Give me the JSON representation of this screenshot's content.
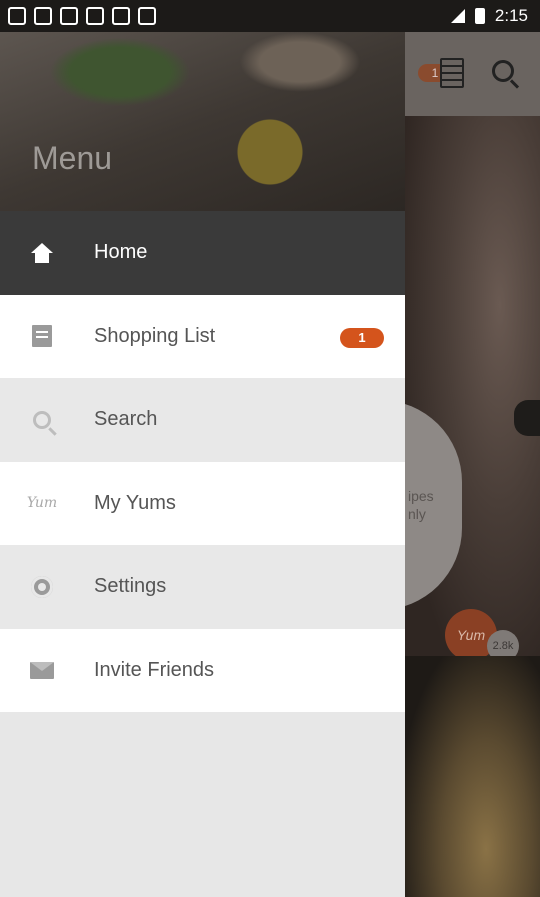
{
  "status_bar": {
    "time": "2:15"
  },
  "background": {
    "cart_badge": "1",
    "bubble_text_line1": "ipes",
    "bubble_text_line2": "nly",
    "yum_label": "Yum",
    "yum_count": "2.8k"
  },
  "drawer": {
    "title": "Menu",
    "items": [
      {
        "label": "Home",
        "icon": "home-icon"
      },
      {
        "label": "Shopping List",
        "icon": "list-icon",
        "badge": "1"
      },
      {
        "label": "Search",
        "icon": "search-icon"
      },
      {
        "label": "My Yums",
        "icon": "yum-icon",
        "icon_text": "Yum"
      },
      {
        "label": "Settings",
        "icon": "gear-icon"
      },
      {
        "label": "Invite Friends",
        "icon": "mail-icon"
      }
    ]
  },
  "colors": {
    "accent": "#d4541c",
    "active_row": "#3a3a3a"
  }
}
